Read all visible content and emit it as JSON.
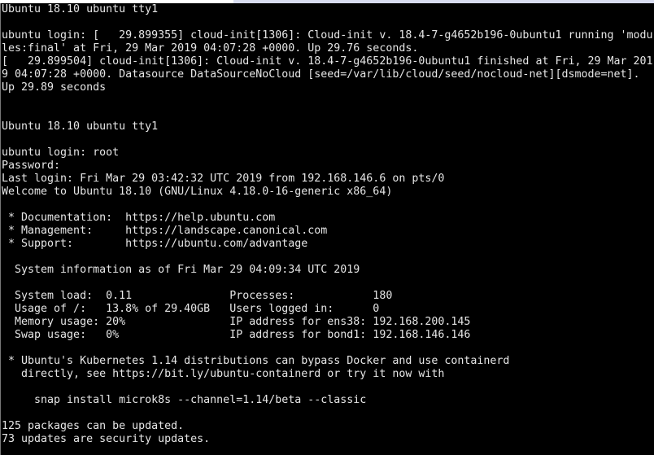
{
  "terminal": {
    "lines": [
      "Ubuntu 18.10 ubuntu tty1",
      "",
      "ubuntu login: [   29.899355] cloud-init[1306]: Cloud-init v. 18.4-7-g4652b196-0ubuntu1 running 'modu",
      "les:final' at Fri, 29 Mar 2019 04:07:28 +0000. Up 29.76 seconds.",
      "[   29.899504] cloud-init[1306]: Cloud-init v. 18.4-7-g4652b196-0ubuntu1 finished at Fri, 29 Mar 201",
      "9 04:07:28 +0000. Datasource DataSourceNoCloud [seed=/var/lib/cloud/seed/nocloud-net][dsmode=net].",
      "Up 29.89 seconds",
      "",
      "",
      "Ubuntu 18.10 ubuntu tty1",
      "",
      "ubuntu login: root",
      "Password:",
      "Last login: Fri Mar 29 03:42:32 UTC 2019 from 192.168.146.6 on pts/0",
      "Welcome to Ubuntu 18.10 (GNU/Linux 4.18.0-16-generic x86_64)",
      "",
      " * Documentation:  https://help.ubuntu.com",
      " * Management:     https://landscape.canonical.com",
      " * Support:        https://ubuntu.com/advantage",
      "",
      "  System information as of Fri Mar 29 04:09:34 UTC 2019",
      "",
      "  System load:  0.11               Processes:            180",
      "  Usage of /:   13.8% of 29.40GB   Users logged in:      0",
      "  Memory usage: 20%                IP address for ens38: 192.168.200.145",
      "  Swap usage:   0%                 IP address for bond1: 192.168.146.146",
      "",
      " * Ubuntu's Kubernetes 1.14 distributions can bypass Docker and use containerd",
      "   directly, see https://bit.ly/ubuntu-containerd or try it now with",
      "",
      "     snap install microk8s --channel=1.14/beta --classic",
      "",
      "125 packages can be updated.",
      "73 updates are security updates."
    ]
  }
}
